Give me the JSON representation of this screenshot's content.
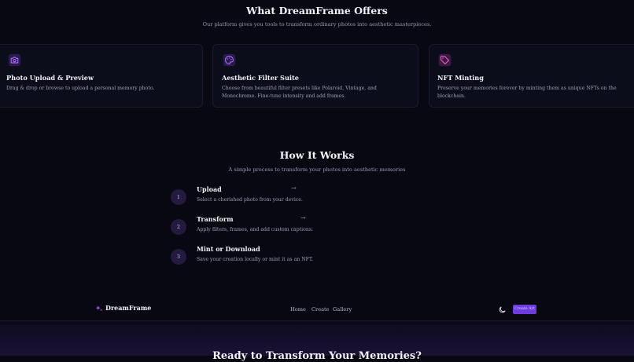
{
  "offers": {
    "title": "What DreamFrame Offers",
    "subtitle": "Our platform gives you tools to transform ordinary photos into aesthetic masterpieces.",
    "cards": [
      {
        "title": "Photo Upload & Preview",
        "description": "Drag & drop or browse to upload a personal memory photo.",
        "icon": "camera-icon",
        "color": "#a36bff"
      },
      {
        "title": "Aesthetic Filter Suite",
        "description": "Choose from beautiful filter presets like Polaroid, Vintage, and Monochrome. Fine-tune intensity and add frames.",
        "icon": "palette-icon",
        "color": "#a36bff"
      },
      {
        "title": "NFT Minting",
        "description": "Preserve your memories forever by minting them as unique NFTs on the blockchain.",
        "icon": "tag-icon",
        "color": "#e05bc7"
      }
    ]
  },
  "how": {
    "title": "How It Works",
    "subtitle": "A simple process to transform your photos into aesthetic memories",
    "steps": [
      {
        "number": "1",
        "title": "Upload",
        "description": "Select a cherished photo from your device.",
        "arrow": "→"
      },
      {
        "number": "2",
        "title": "Transform",
        "description": "Apply filters, frames, and add custom captions.",
        "arrow": "→"
      },
      {
        "number": "3",
        "title": "Mint or Download",
        "description": "Save your creation locally or mint it as an NFT."
      }
    ]
  },
  "nav": {
    "brand": "DreamFrame",
    "links": [
      "Home",
      "Create",
      "Gallery"
    ],
    "cta_label": "Create Art",
    "theme_icon": "moon-icon"
  },
  "cta_section": {
    "title": "Ready to Transform Your Memories?"
  },
  "colors": {
    "accent": "#6c3ce0",
    "background": "#070812"
  }
}
